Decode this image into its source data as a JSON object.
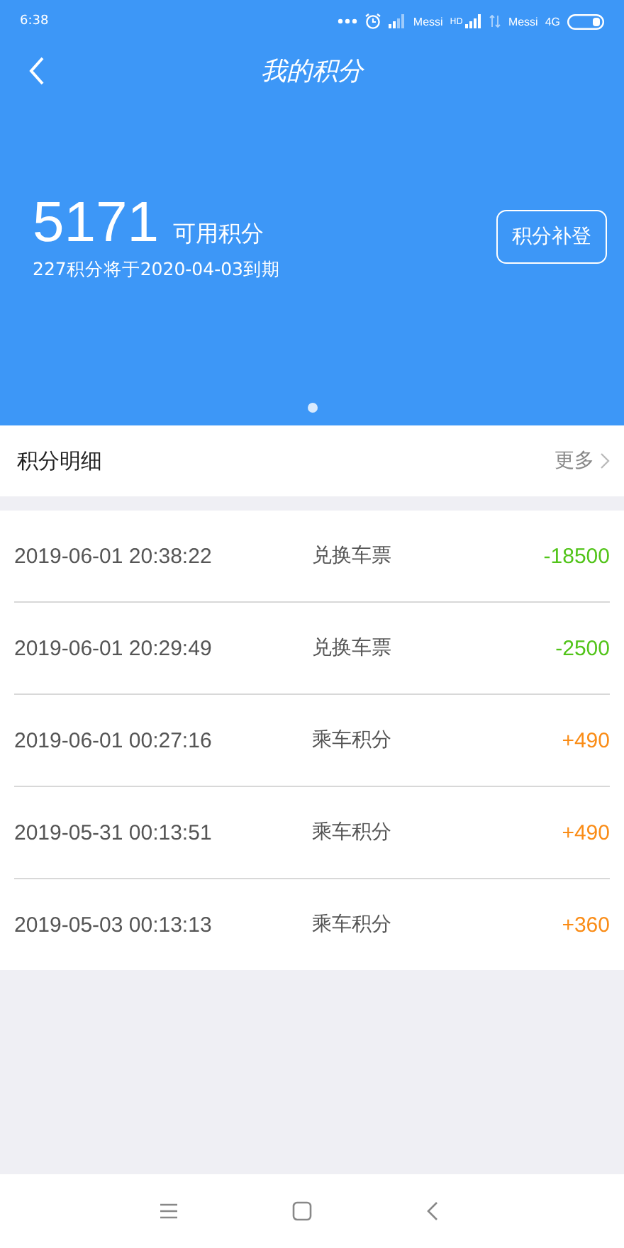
{
  "status_bar": {
    "time": "6:38",
    "carrier_1": "Messi",
    "signal_badge": "HD",
    "carrier_2": "Messi",
    "network": "4G"
  },
  "header": {
    "title": "我的积分"
  },
  "summary": {
    "points": "5171",
    "points_label": "可用积分",
    "expiry": "227积分将于2020-04-03到期",
    "button": "积分补登"
  },
  "pager": [
    {
      "selected": true
    }
  ],
  "details": {
    "title": "积分明细",
    "more": "更多"
  },
  "records": [
    {
      "time": "2019-06-01 20:38:22",
      "type": "兑换车票",
      "amount": "-18500",
      "color": "#52c41a"
    },
    {
      "time": "2019-06-01 20:29:49",
      "type": "兑换车票",
      "amount": "-2500",
      "color": "#52c41a"
    },
    {
      "time": "2019-06-01 00:27:16",
      "type": "乘车积分",
      "amount": "+490",
      "color": "#fa8c16"
    },
    {
      "time": "2019-05-31 00:13:51",
      "type": "乘车积分",
      "amount": "+490",
      "color": "#fa8c16"
    },
    {
      "time": "2019-05-03 00:13:13",
      "type": "乘车积分",
      "amount": "+360",
      "color": "#fa8c16"
    }
  ]
}
